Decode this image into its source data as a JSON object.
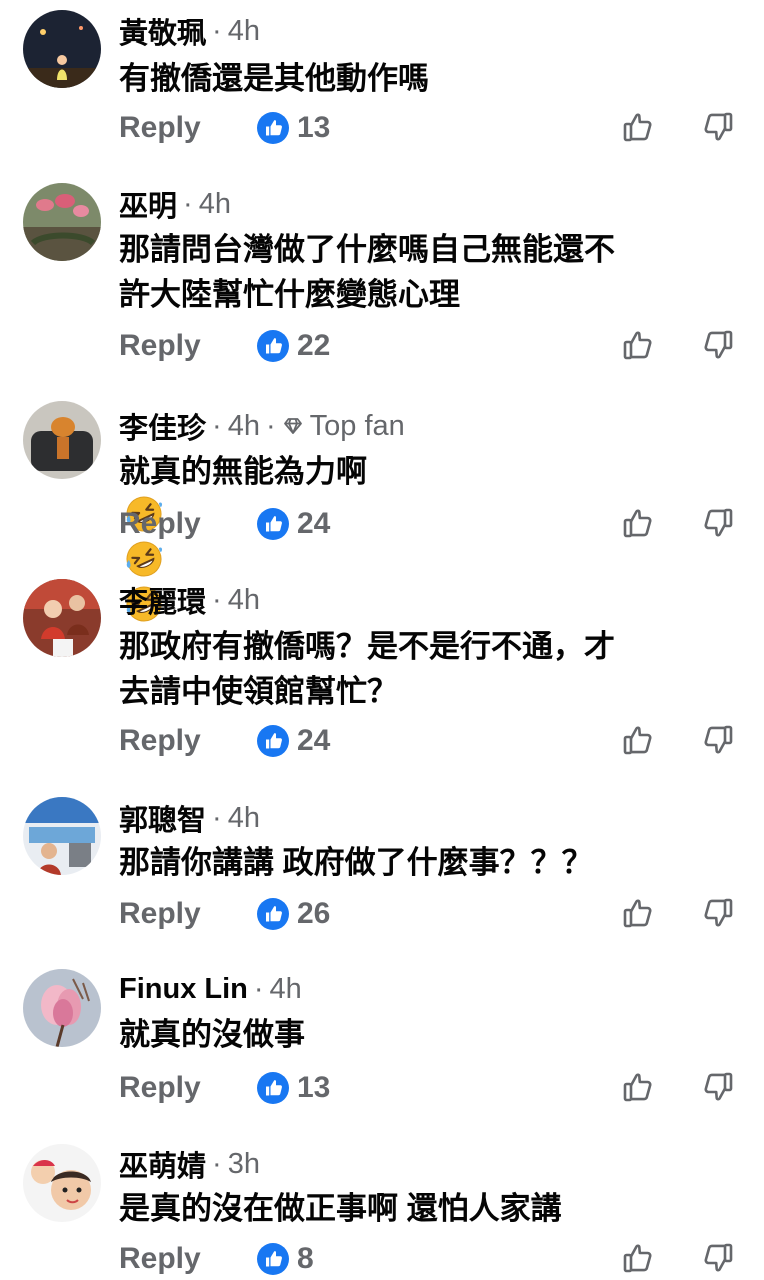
{
  "colors": {
    "meta_text": "#65676b",
    "body_text": "#050505",
    "like_blue": "#1877f2",
    "emoji_yellow": "#f7b928"
  },
  "icons": {
    "like": "like-badge-icon",
    "upvote": "thumbs-up-outline-icon",
    "downvote": "thumbs-down-outline-icon",
    "top_fan": "diamond-icon",
    "laugh": "rolling-on-floor-laughing-emoji"
  },
  "comments": [
    {
      "author": "黃敬珮",
      "time": "4h",
      "text": "有撤僑還是其他動作嗎",
      "reply_label": "Reply",
      "like_count": "13"
    },
    {
      "author": "巫明",
      "time": "4h",
      "text": "那請問台灣做了什麼嗎自己無能還不\n許大陸幫忙什麼變態心理",
      "reply_label": "Reply",
      "like_count": "22"
    },
    {
      "author": "李佳珍",
      "time": "4h",
      "badge": "Top fan",
      "text": "就真的無能為力啊",
      "reply_label": "Reply",
      "like_count": "24"
    },
    {
      "author": "李麗環",
      "time": "4h",
      "text": "那政府有撤僑嗎？是不是行不通，才\n去請中使領館幫忙？",
      "reply_label": "Reply",
      "like_count": "24"
    },
    {
      "author": "郭聰智",
      "time": "4h",
      "text": "那請你講講 政府做了什麼事？？？",
      "reply_label": "Reply",
      "like_count": "26"
    },
    {
      "author": "Finux Lin",
      "time": "4h",
      "text": "就真的沒做事",
      "reply_label": "Reply",
      "like_count": "13"
    },
    {
      "author": "巫萌婧",
      "time": "3h",
      "text": "是真的沒在做正事啊 還怕人家講",
      "reply_label": "Reply",
      "like_count": "8"
    }
  ]
}
